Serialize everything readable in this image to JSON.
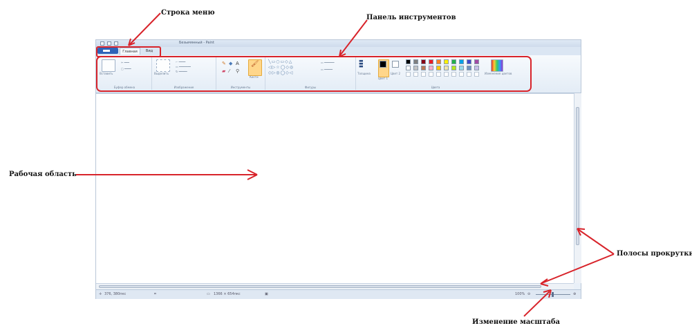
{
  "annotations": {
    "menu_bar": "Строка меню",
    "toolbar": "Панель инструментов",
    "work_area": "Рабочая область",
    "scrollbars": "Полосы прокрутки",
    "zoom": "Изменение масштаба"
  },
  "window": {
    "title": "Безымянный - Paint",
    "tabs": [
      "Главная",
      "Вид"
    ],
    "ribbon": {
      "groups": [
        "Буфер обмена",
        "Изображение",
        "Инструменты",
        "Фигуры",
        "Цвета"
      ],
      "paste_label": "Вставить",
      "select_label": "Выделить",
      "brushes_label": "Кисти",
      "thickness_label": "Толщина",
      "color1_label": "Цвет 1",
      "color2_label": "Цвет 2",
      "edit_colors_label": "Изменение цветов"
    },
    "palette": [
      "#000000",
      "#7f7f7f",
      "#880015",
      "#ed1c24",
      "#ff7f27",
      "#fff200",
      "#22b14c",
      "#00a2e8",
      "#3f48cc",
      "#a349a4",
      "#ffffff",
      "#c3c3c3",
      "#b97a57",
      "#ffaec9",
      "#ffc90e",
      "#efe4b0",
      "#b5e61d",
      "#99d9ea",
      "#7092be",
      "#c8bfe7"
    ],
    "status": {
      "position": "376, 380пкс",
      "size": "1366 × 654пкс",
      "zoom": "100%"
    }
  },
  "colors": {
    "annotation_red": "#d8232a",
    "ribbon_bg": "#e9f0f8"
  }
}
